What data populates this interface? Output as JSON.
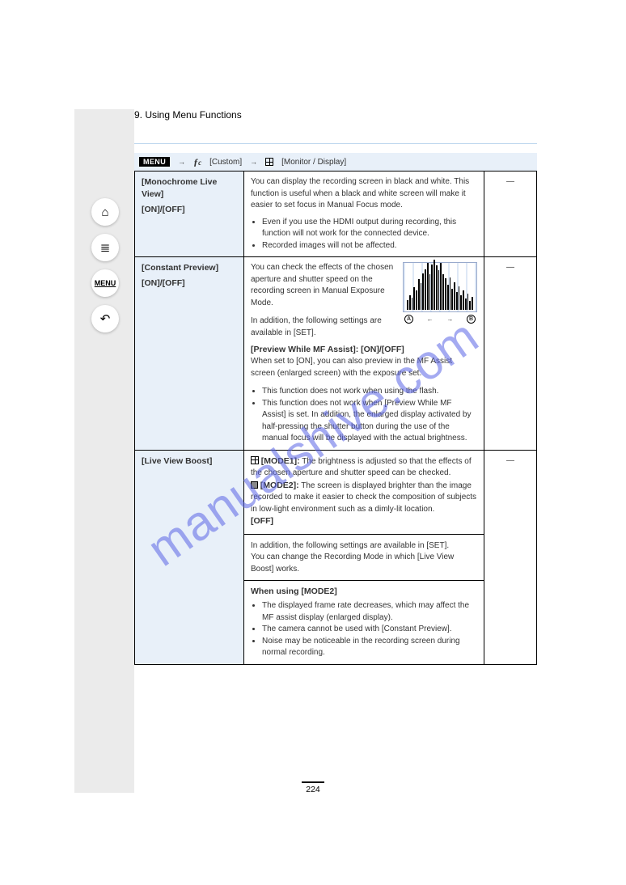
{
  "page_number": "224",
  "top_title": "9. Using Menu Functions",
  "crumb": {
    "menu": "MENU",
    "arrow": "→",
    "custom": "[Custom]",
    "arrow2": "→",
    "tab": "[Monitor / Display]"
  },
  "watermark": "manualshive.com",
  "section1": {
    "header1": "[Monochrome Live View]",
    "header2": "[ON]/[OFF]",
    "desc": "You can display the recording screen in black and white. This function is useful when a black and white screen will make it easier to set focus in Manual Focus mode.",
    "bul1": "Even if you use the HDMI output during recording, this function will not work for the connected device.",
    "bul2": "Recorded images will not be affected.",
    "right": "—"
  },
  "section2": {
    "header1": "[Constant Preview]",
    "header2": "[ON]/[OFF]",
    "para1": "You can check the effects of the chosen aperture and shutter speed on the recording screen in Manual Exposure Mode.",
    "addl_h": "In addition, the following settings are available in [SET].",
    "sub_h": "[Preview While MF Assist]: [ON]/[OFF]",
    "sub_p": "When set to [ON], you can also preview in the MF Assist screen (enlarged screen) with the exposure set.",
    "bul1": "This function does not work when using the flash.",
    "bul2": "This function does not work when [Preview While MF Assist] is set. In addition, the enlarged display activated by half-pressing the shutter button during the use of the manual focus will be displayed with the actual brightness.",
    "graph_label_a": "A",
    "graph_label_b": "B",
    "right": "—"
  },
  "section3": {
    "header1": "[Live View Boost]",
    "opt1_label": "[MODE1]:",
    "opt1_desc": "The brightness is adjusted so that the effects of the chosen aperture and shutter speed can be checked.",
    "opt2_label": "[MODE2]:",
    "opt2_desc": "The screen is displayed brighter than the image recorded to make it easier to check the composition of subjects in low-light environment such as a dimly-lit location.",
    "opt3_label": "[OFF]",
    "set_h": "In addition, the following settings are available in [SET].",
    "set_p": "You can change the Recording Mode in which [Live View Boost] works.",
    "note_h": "When using [MODE2]",
    "bul1": "The displayed frame rate decreases, which may affect the MF assist display (enlarged display).",
    "bul2": "The camera cannot be used with [Constant Preview].",
    "bul3": "Noise may be noticeable in the recording screen during normal recording.",
    "right": "—"
  },
  "histogram": [
    12,
    18,
    15,
    28,
    24,
    38,
    33,
    45,
    50,
    58,
    44,
    56,
    62,
    55,
    49,
    58,
    44,
    39,
    31,
    40,
    26,
    34,
    22,
    29,
    18,
    24,
    14,
    20,
    11,
    16
  ],
  "nav": {
    "home": "⌂",
    "list": "≣",
    "menu": "MENU",
    "back": "↶"
  }
}
